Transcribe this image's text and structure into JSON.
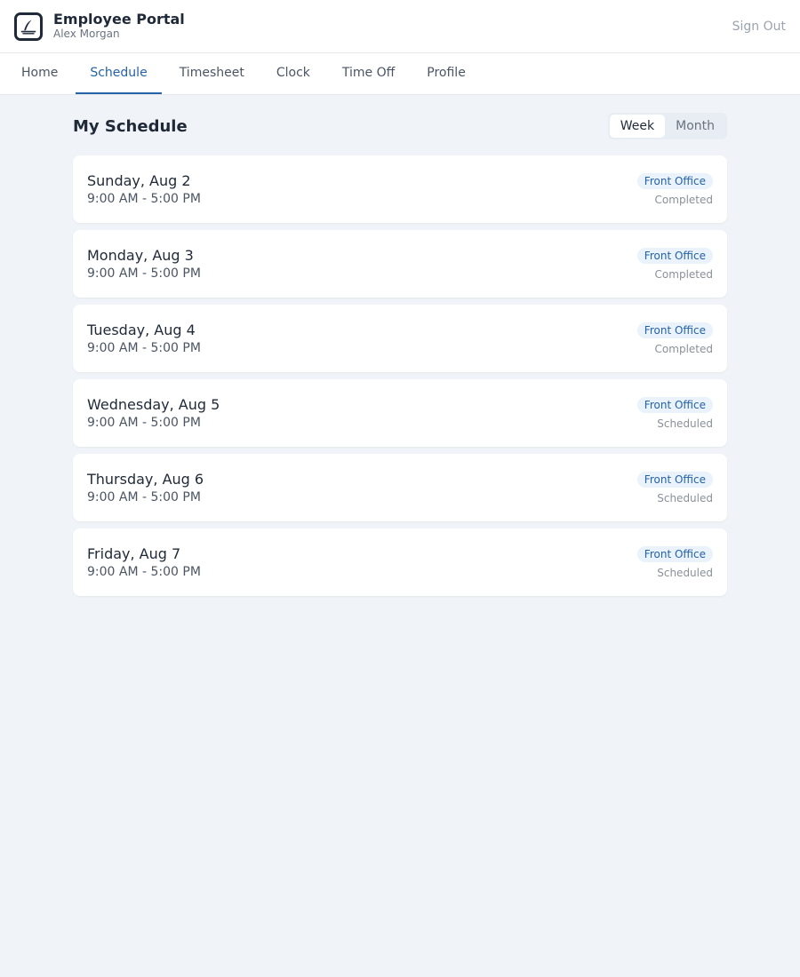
{
  "header": {
    "app_title": "Employee Portal",
    "user_name": "Alex Morgan",
    "sign_out": "Sign Out"
  },
  "nav": {
    "tabs": [
      {
        "label": "Home"
      },
      {
        "label": "Schedule"
      },
      {
        "label": "Timesheet"
      },
      {
        "label": "Clock"
      },
      {
        "label": "Time Off"
      },
      {
        "label": "Profile"
      }
    ],
    "active": "Schedule"
  },
  "main": {
    "title": "My Schedule",
    "view_toggle": {
      "week": "Week",
      "month": "Month",
      "selected": "Week"
    },
    "shifts": [
      {
        "day": "Sunday, Aug 2",
        "time": "9:00 AM - 5:00 PM",
        "location": "Front Office",
        "status": "Completed"
      },
      {
        "day": "Monday, Aug 3",
        "time": "9:00 AM - 5:00 PM",
        "location": "Front Office",
        "status": "Completed"
      },
      {
        "day": "Tuesday, Aug 4",
        "time": "9:00 AM - 5:00 PM",
        "location": "Front Office",
        "status": "Completed"
      },
      {
        "day": "Wednesday, Aug 5",
        "time": "9:00 AM - 5:00 PM",
        "location": "Front Office",
        "status": "Scheduled"
      },
      {
        "day": "Thursday, Aug 6",
        "time": "9:00 AM - 5:00 PM",
        "location": "Front Office",
        "status": "Scheduled"
      },
      {
        "day": "Friday, Aug 7",
        "time": "9:00 AM - 5:00 PM",
        "location": "Front Office",
        "status": "Scheduled"
      }
    ]
  },
  "colors": {
    "accent": "#2563a8",
    "background": "#f0f4f8",
    "badge_bg": "#eaf2fb"
  },
  "icons": {
    "logo": "feather-logo-icon"
  }
}
